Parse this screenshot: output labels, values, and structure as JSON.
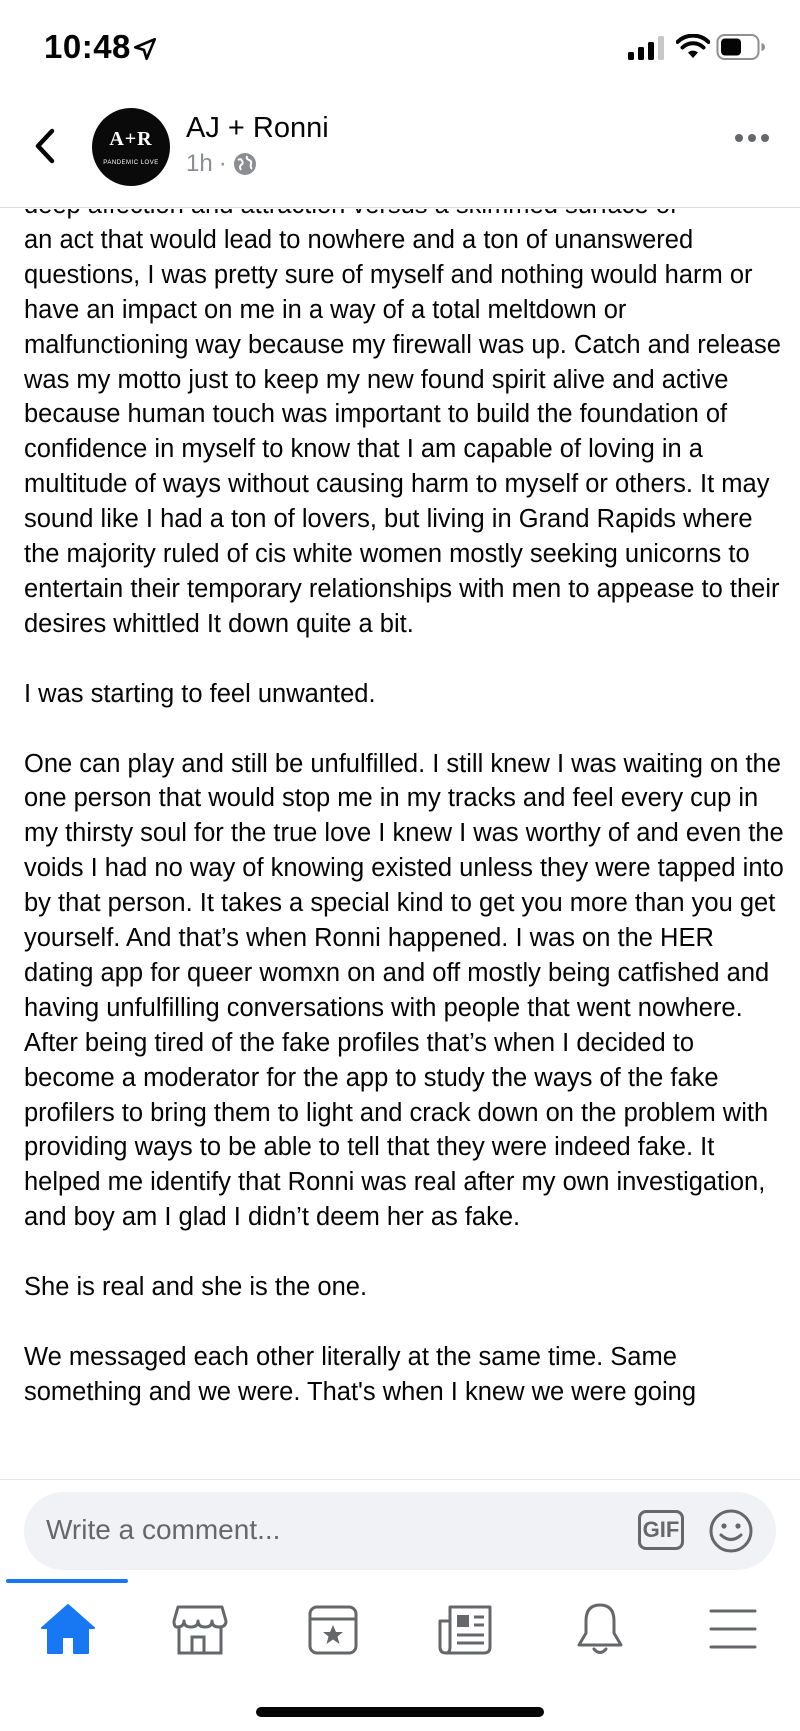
{
  "status_bar": {
    "time": "10:48",
    "icons": [
      "location-arrow-icon",
      "cellular-signal-icon",
      "wifi-icon",
      "battery-icon"
    ]
  },
  "header": {
    "author": "AJ + Ronni",
    "timestamp": "1h",
    "separator": "·",
    "avatar": {
      "monogram": "A+R",
      "tagline": "PANDEMIC LOVE"
    }
  },
  "post": {
    "text": "deep affection and attraction versus a skimmed surface of\nan act that would lead to nowhere and a ton of unanswered questions, I was pretty sure of myself and nothing would harm or have an impact on me in a way of a total meltdown or malfunctioning way because my firewall was up. Catch and release was my motto just to keep my new found spirit alive and active because human touch was important to build the foundation of confidence in myself to know that I am capable of loving in a multitude of ways without causing harm to myself or others. It may sound like I had a ton of lovers, but living in Grand Rapids where the majority ruled of cis white women mostly seeking unicorns to entertain their temporary relationships with men to appease to their desires whittled It down quite a bit.\n\nI was starting to feel unwanted.\n\nOne can play and still be unfulfilled. I still knew I was waiting on the one person that would stop me in my tracks and feel every cup in my thirsty soul for the true love I knew I was worthy of and even the voids I had no way of knowing existed unless they were tapped into by that person. It takes a special kind to get you more than you get yourself. And that’s when Ronni happened. I was on the HER dating app for queer womxn on and off mostly being catfished and having unfulfilling conversations with people that went nowhere. After being tired of the fake profiles that’s when I decided to become a moderator for the app to study the ways of the fake profilers to bring them to light and crack down on the problem with providing ways to be able to tell that they were indeed fake. It helped me identify that Ronni was real after my own investigation, and boy am I glad I didn’t deem her as fake.\n\nShe is real and she is the one.\n\nWe messaged each other literally at the same time. Same\nsomething and we were. That's when I knew we were going"
  },
  "comment": {
    "placeholder": "Write a comment...",
    "gif_label": "GIF"
  },
  "tabs": [
    {
      "name": "home",
      "active": true
    },
    {
      "name": "marketplace",
      "active": false
    },
    {
      "name": "events",
      "active": false
    },
    {
      "name": "news",
      "active": false
    },
    {
      "name": "notifications",
      "active": false
    },
    {
      "name": "menu",
      "active": false
    }
  ],
  "colors": {
    "accent": "#1877f2",
    "text": "#050505",
    "secondary_text": "#65676b",
    "input_bg": "#f0f2f5",
    "icon": "#65676b"
  }
}
